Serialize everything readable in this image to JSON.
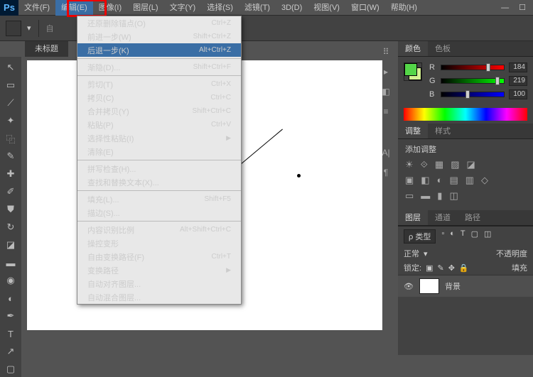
{
  "app": {
    "logo": "Ps"
  },
  "menubar": {
    "items": [
      "文件(F)",
      "编辑(E)",
      "图像(I)",
      "图层(L)",
      "文字(Y)",
      "选择(S)",
      "滤镜(T)",
      "3D(D)",
      "视图(V)",
      "窗口(W)",
      "帮助(H)"
    ]
  },
  "doc_tab": "未标题",
  "edit_menu": [
    {
      "label": "还原删除锚点(O)",
      "shortcut": "Ctrl+Z"
    },
    {
      "label": "前进一步(W)",
      "shortcut": "Shift+Ctrl+Z"
    },
    {
      "label": "后退一步(K)",
      "shortcut": "Alt+Ctrl+Z",
      "hi": true
    },
    {
      "sep": true
    },
    {
      "label": "渐隐(D)...",
      "shortcut": "Shift+Ctrl+F",
      "disabled": true
    },
    {
      "sep": true
    },
    {
      "label": "剪切(T)",
      "shortcut": "Ctrl+X"
    },
    {
      "label": "拷贝(C)",
      "shortcut": "Ctrl+C"
    },
    {
      "label": "合并拷贝(Y)",
      "shortcut": "Shift+Ctrl+C",
      "disabled": true
    },
    {
      "label": "粘贴(P)",
      "shortcut": "Ctrl+V"
    },
    {
      "label": "选择性粘贴(I)",
      "sub": true
    },
    {
      "label": "清除(E)",
      "disabled": true
    },
    {
      "sep": true
    },
    {
      "label": "拼写检查(H)...",
      "disabled": true
    },
    {
      "label": "查找和替换文本(X)...",
      "disabled": true
    },
    {
      "sep": true
    },
    {
      "label": "填充(L)...",
      "shortcut": "Shift+F5"
    },
    {
      "label": "描边(S)...",
      "disabled": true
    },
    {
      "sep": true
    },
    {
      "label": "内容识别比例",
      "shortcut": "Alt+Shift+Ctrl+C",
      "disabled": true
    },
    {
      "label": "操控变形",
      "disabled": true
    },
    {
      "label": "自由变换路径(F)",
      "shortcut": "Ctrl+T"
    },
    {
      "label": "变换路径",
      "sub": true
    },
    {
      "label": "自动对齐图层...",
      "disabled": true
    },
    {
      "label": "自动混合图层...",
      "disabled": true
    }
  ],
  "color_panel": {
    "tabs": [
      "颜色",
      "色板"
    ],
    "channels": [
      {
        "label": "R",
        "value": "184",
        "grad": "linear-gradient(90deg,#000,#f00)",
        "pos": 72
      },
      {
        "label": "G",
        "value": "219",
        "grad": "linear-gradient(90deg,#000,#0f0)",
        "pos": 86
      },
      {
        "label": "B",
        "value": "100",
        "grad": "linear-gradient(90deg,#000,#00f)",
        "pos": 39
      }
    ]
  },
  "adjust_panel": {
    "tabs": [
      "调整",
      "样式"
    ],
    "title": "添加调整",
    "row1": [
      "☀",
      "⟐",
      "▦",
      "▨",
      "◪"
    ],
    "row2": [
      "▣",
      "◧",
      "◐",
      "▤",
      "▥",
      "◇"
    ],
    "row3": [
      "▭",
      "▬",
      "▮",
      "◫"
    ]
  },
  "layers_panel": {
    "tabs": [
      "图层",
      "通道",
      "路径"
    ],
    "kind": "ρ 类型",
    "mode": "正常",
    "opacity_label": "不透明度",
    "lock_label": "锁定:",
    "fill_label": "填充",
    "layer_name": "背景"
  }
}
